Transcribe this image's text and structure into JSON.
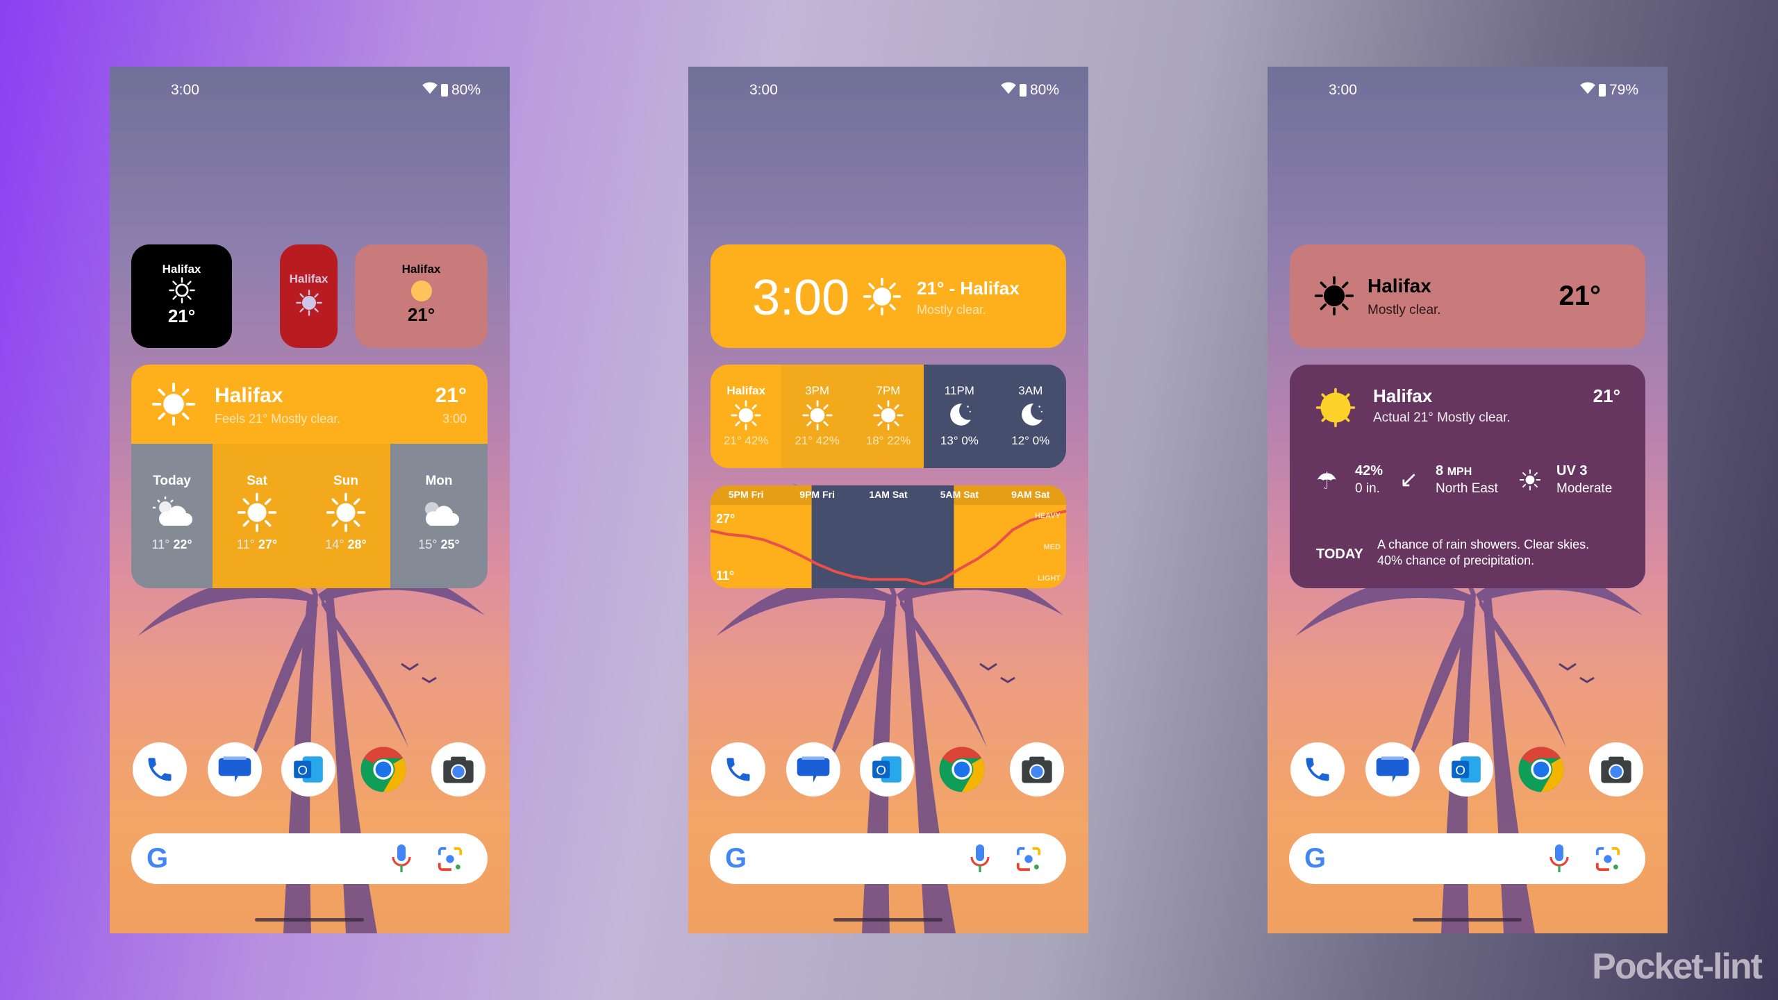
{
  "phones": [
    {
      "status": {
        "time": "3:00",
        "battery": "80%"
      }
    },
    {
      "status": {
        "time": "3:00",
        "battery": "80%"
      }
    },
    {
      "status": {
        "time": "3:00",
        "battery": "79%"
      }
    }
  ],
  "dock": {
    "apps": [
      "phone",
      "messages",
      "outlook",
      "chrome",
      "camera"
    ]
  },
  "phone1": {
    "black_widget": {
      "city": "Halifax",
      "temp": "21°",
      "icon": "sun-outline-icon"
    },
    "red_widget": {
      "city": "Halifax",
      "icon": "sun-dotted-icon"
    },
    "pink_widget": {
      "city": "Halifax",
      "temp": "21°",
      "icon": "sun-circle-icon"
    },
    "forecast_widget": {
      "city": "Halifax",
      "subtitle": "Feels 21° Mostly clear.",
      "temp": "21°",
      "time": "3:00",
      "days": [
        {
          "label": "Today",
          "low": "11°",
          "high": "22°",
          "icon": "partly-cloudy-icon",
          "bg": "#858b96"
        },
        {
          "label": "Sat",
          "low": "11°",
          "high": "27°",
          "icon": "sun-icon",
          "bg": "#f2a91c"
        },
        {
          "label": "Sun",
          "low": "14°",
          "high": "28°",
          "icon": "sun-icon",
          "bg": "#f2a91c"
        },
        {
          "label": "Mon",
          "low": "15°",
          "high": "25°",
          "icon": "cloudy-icon",
          "bg": "#858b96"
        }
      ]
    }
  },
  "phone2": {
    "clock_widget": {
      "time": "3:00",
      "title": "21° - Halifax",
      "subtitle": "Mostly clear."
    },
    "hourly": [
      {
        "label": "Halifax",
        "temp": "21°",
        "precip": "42%",
        "icon": "sun-icon",
        "night": false
      },
      {
        "label": "3PM",
        "temp": "21°",
        "precip": "42%",
        "icon": "sun-icon",
        "night": false
      },
      {
        "label": "7PM",
        "temp": "18°",
        "precip": "22%",
        "icon": "sun-icon",
        "night": false
      },
      {
        "label": "11PM",
        "temp": "13°",
        "precip": "0%",
        "icon": "moon-icon",
        "night": true
      },
      {
        "label": "3AM",
        "temp": "12°",
        "precip": "0%",
        "icon": "moon-icon",
        "night": true
      }
    ]
  },
  "chart_data": {
    "type": "line",
    "time_labels": [
      "5PM Fri",
      "9PM Fri",
      "1AM Sat",
      "5AM Sat",
      "9AM Sat"
    ],
    "x": [
      "3PM",
      "4PM",
      "5PM",
      "6PM",
      "7PM",
      "8PM",
      "9PM",
      "10PM",
      "11PM",
      "12AM",
      "1AM",
      "2AM",
      "3AM",
      "4AM",
      "5AM",
      "6AM",
      "7AM",
      "8AM",
      "9AM",
      "10AM",
      "11AM"
    ],
    "temps": [
      22.8,
      21.9,
      21.5,
      20.6,
      19,
      17,
      14.8,
      13,
      11.8,
      11.1,
      11.1,
      11.1,
      10,
      11,
      13.6,
      16,
      19,
      23,
      25.3,
      26.5,
      27.5
    ],
    "y_labels": {
      "max": "27°",
      "min": "11°"
    },
    "precip_labels": [
      "HEAVY",
      "MED",
      "LIGHT"
    ],
    "ylim": [
      9,
      29
    ],
    "night": [
      "9PM",
      "5AM"
    ],
    "line_color": "#e8504a"
  },
  "phone3": {
    "simple_widget": {
      "city": "Halifax",
      "subtitle": "Mostly clear.",
      "temp": "21°"
    },
    "detail_widget": {
      "city": "Halifax",
      "subtitle": "Actual 21° Mostly clear.",
      "temp": "21°",
      "precip": {
        "value": "42%",
        "amount": "0 in."
      },
      "wind": {
        "speed": "8",
        "unit": "MPH",
        "direction": "North East"
      },
      "uv": {
        "value": "UV 3",
        "level": "Moderate"
      },
      "today_label": "TODAY",
      "today_text": "A chance of rain showers. Clear skies. 40% chance of precipitation."
    }
  },
  "watermark": "Pocket-lint",
  "colors": {
    "amber": "#fdb01c",
    "night": "#464e6e",
    "pink": "#c97b7b",
    "plum": "#673660",
    "red": "#b81c20"
  }
}
